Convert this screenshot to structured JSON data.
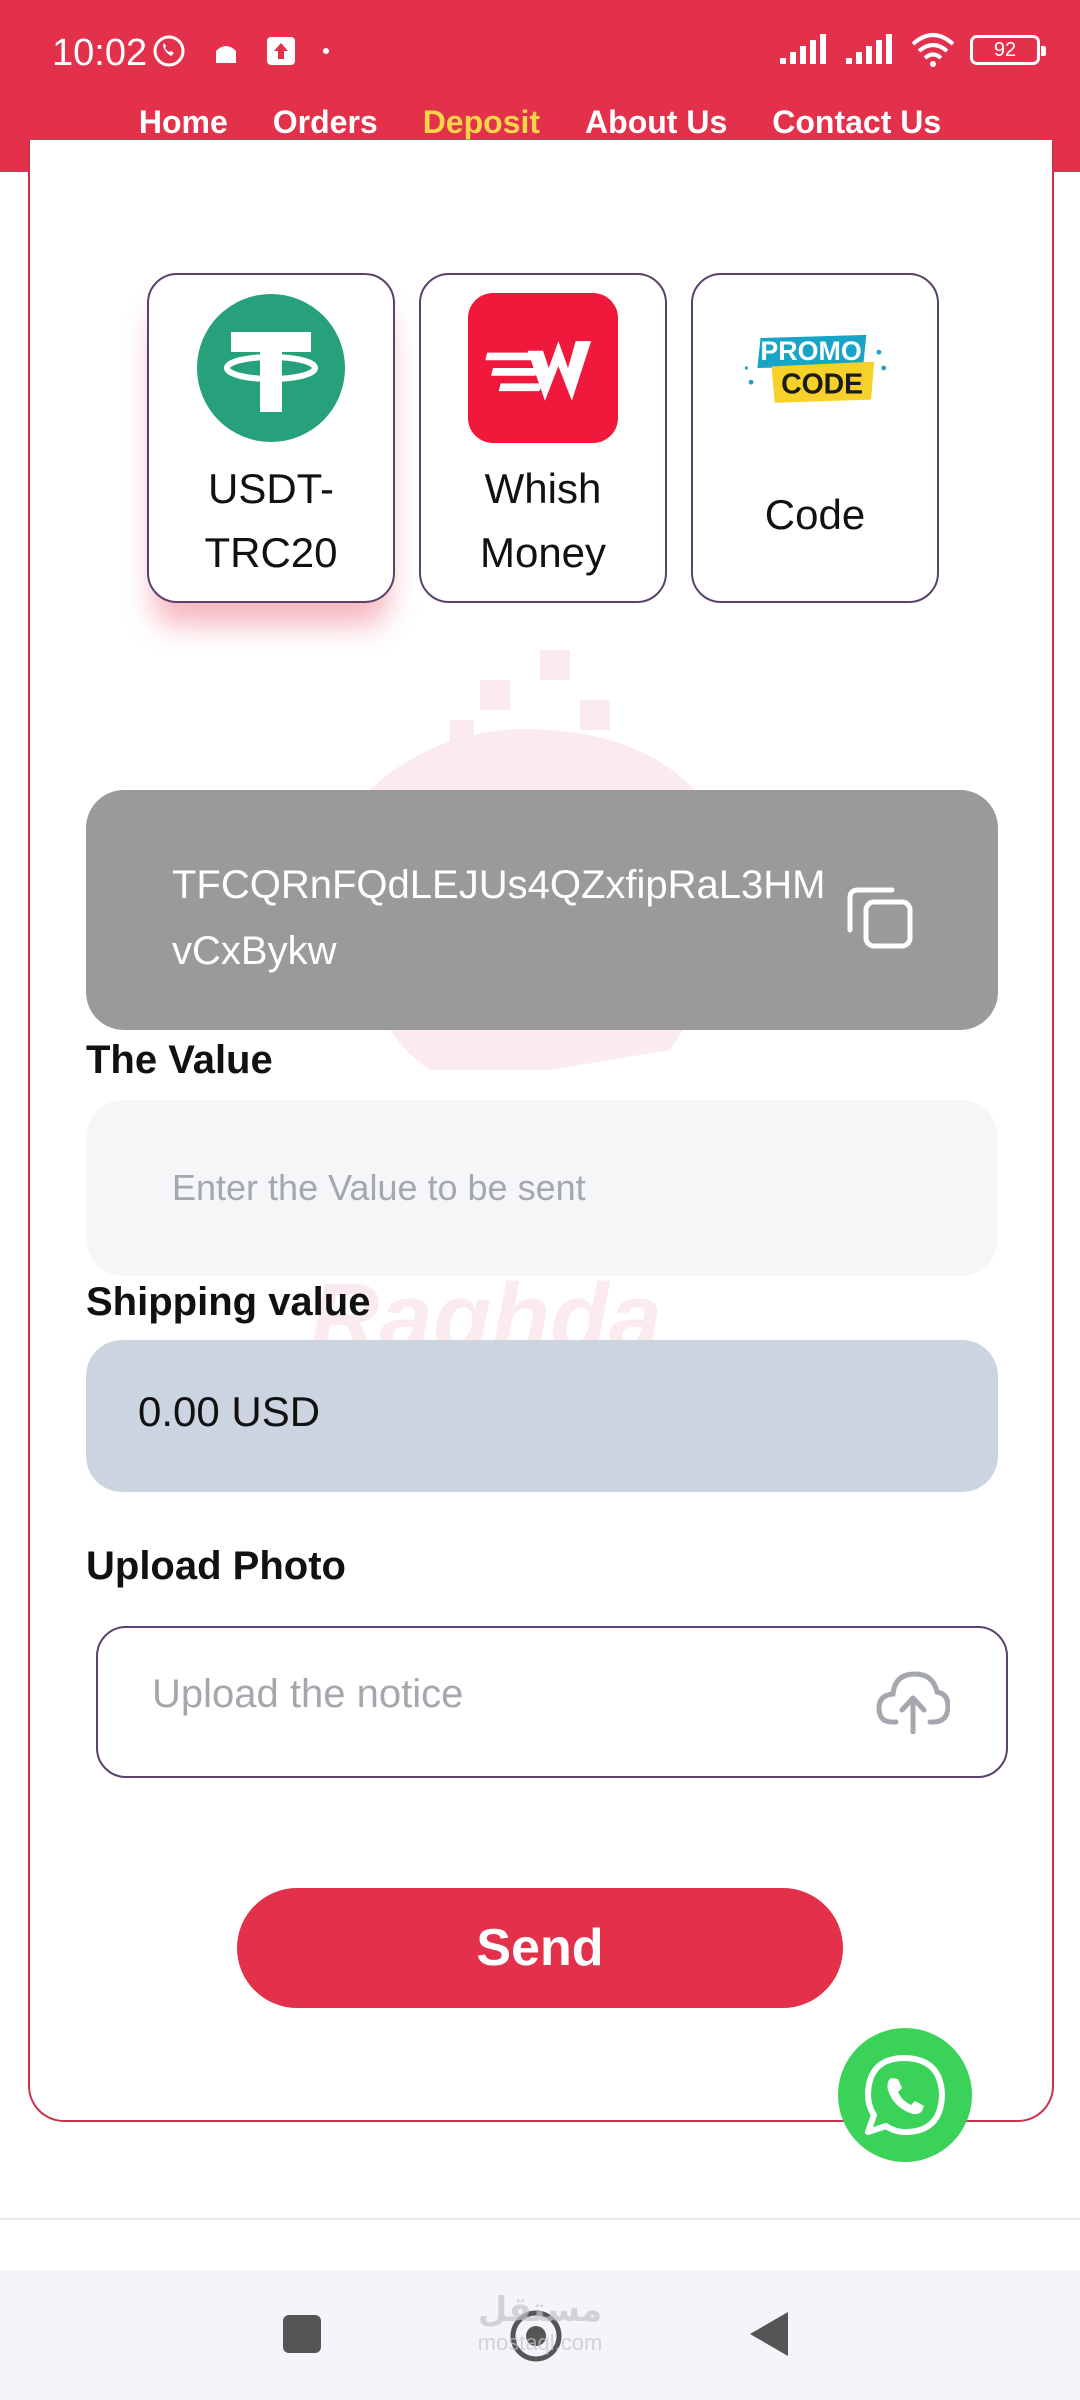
{
  "status_bar": {
    "time": "10:02",
    "battery": "92"
  },
  "nav": {
    "items": [
      {
        "label": "Home"
      },
      {
        "label": "Orders"
      },
      {
        "label": "Deposit"
      },
      {
        "label": "About Us"
      },
      {
        "label": "Contact Us"
      }
    ],
    "active": "Deposit"
  },
  "methods": [
    {
      "name": "USDT-\nTRC20",
      "line1": "USDT-",
      "line2": "TRC20",
      "icon": "tether-icon",
      "selected": true
    },
    {
      "name": "Whish Money",
      "line1": "Whish",
      "line2": "Money",
      "icon": "whish-logo",
      "selected": false
    },
    {
      "name": "Code",
      "line1": "Code",
      "icon": "promo-code-logo",
      "logo_text_1": "PROMO",
      "logo_text_2": "CODE",
      "selected": false
    }
  ],
  "address": {
    "value": "TFCQRnFQdLEJUs4QZxfipRaL3HMvCxBykw",
    "copy_icon": "copy-icon"
  },
  "value_field": {
    "label": "The Value",
    "placeholder": "Enter the Value to be sent"
  },
  "shipping": {
    "label": "Shipping value",
    "value": "0.00 USD"
  },
  "upload": {
    "label": "Upload Photo",
    "placeholder": "Upload the notice",
    "icon": "cloud-upload-icon"
  },
  "send_button": {
    "label": "Send"
  },
  "watermark": {
    "text": "Raghda"
  },
  "site_mark": {
    "line1": "مستقل",
    "line2": "mostaql.com"
  },
  "colors": {
    "brand_red": "#e3304b",
    "active_nav": "#f7d548",
    "address_bg": "#9a9a9a",
    "shipping_bg": "#cbd4e0",
    "whatsapp_green": "#3bd25a",
    "tether_green": "#26a17b"
  }
}
